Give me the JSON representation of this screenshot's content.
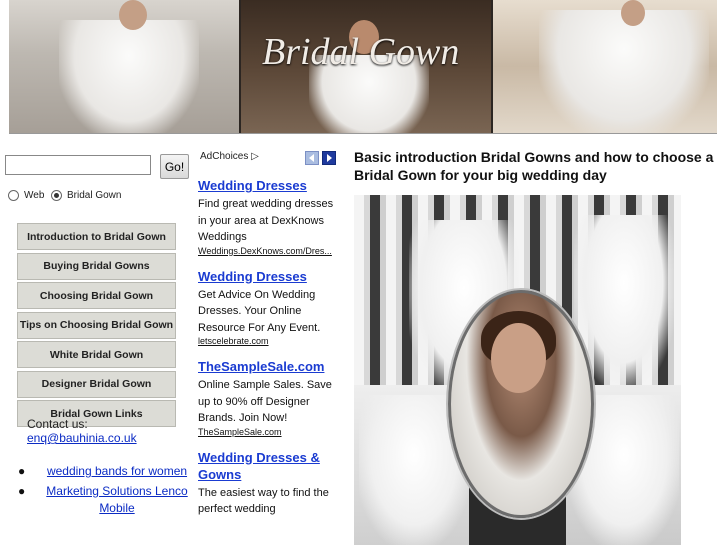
{
  "banner": {
    "title": "Bridal Gown"
  },
  "search": {
    "input_value": "",
    "go_label": "Go!",
    "radio_web": "Web",
    "radio_site": "Bridal Gown",
    "selected": "Bridal Gown"
  },
  "nav": {
    "items": [
      "Introduction to Bridal Gown",
      "Buying Bridal Gowns",
      "Choosing Bridal Gown",
      "Tips on Choosing Bridal Gown",
      "White Bridal Gown",
      "Designer Bridal Gown",
      "Bridal Gown Links"
    ]
  },
  "contact": {
    "label": "Contact us:",
    "email": "enq@bauhinia.co.uk"
  },
  "links": [
    "wedding bands for women",
    "Marketing Solutions Lenco Mobile"
  ],
  "ads": {
    "adchoices_label": "AdChoices",
    "items": [
      {
        "title": "Wedding Dresses",
        "body": "Find great wedding dresses in your area at DexKnows Weddings",
        "url": "Weddings.DexKnows.com/Dres..."
      },
      {
        "title": "Wedding Dresses",
        "body": "Get Advice On Wedding Dresses. Your Online Resource For Any Event.",
        "url": "letscelebrate.com"
      },
      {
        "title": "TheSampleSale.com",
        "body": "Online Sample Sales. Save up to 90% off Designer Brands. Join Now!",
        "url": "TheSampleSale.com"
      },
      {
        "title": "Wedding Dresses & Gowns",
        "body": "The easiest way to find the perfect wedding",
        "url": ""
      }
    ]
  },
  "main": {
    "heading": "Basic introduction Bridal Gowns and how to choose a Bridal Gown for your big wedding day"
  },
  "colors": {
    "link": "#0b2bc4",
    "ad_title": "#1a3bd1",
    "nav_bg": "#dcdcd6"
  }
}
